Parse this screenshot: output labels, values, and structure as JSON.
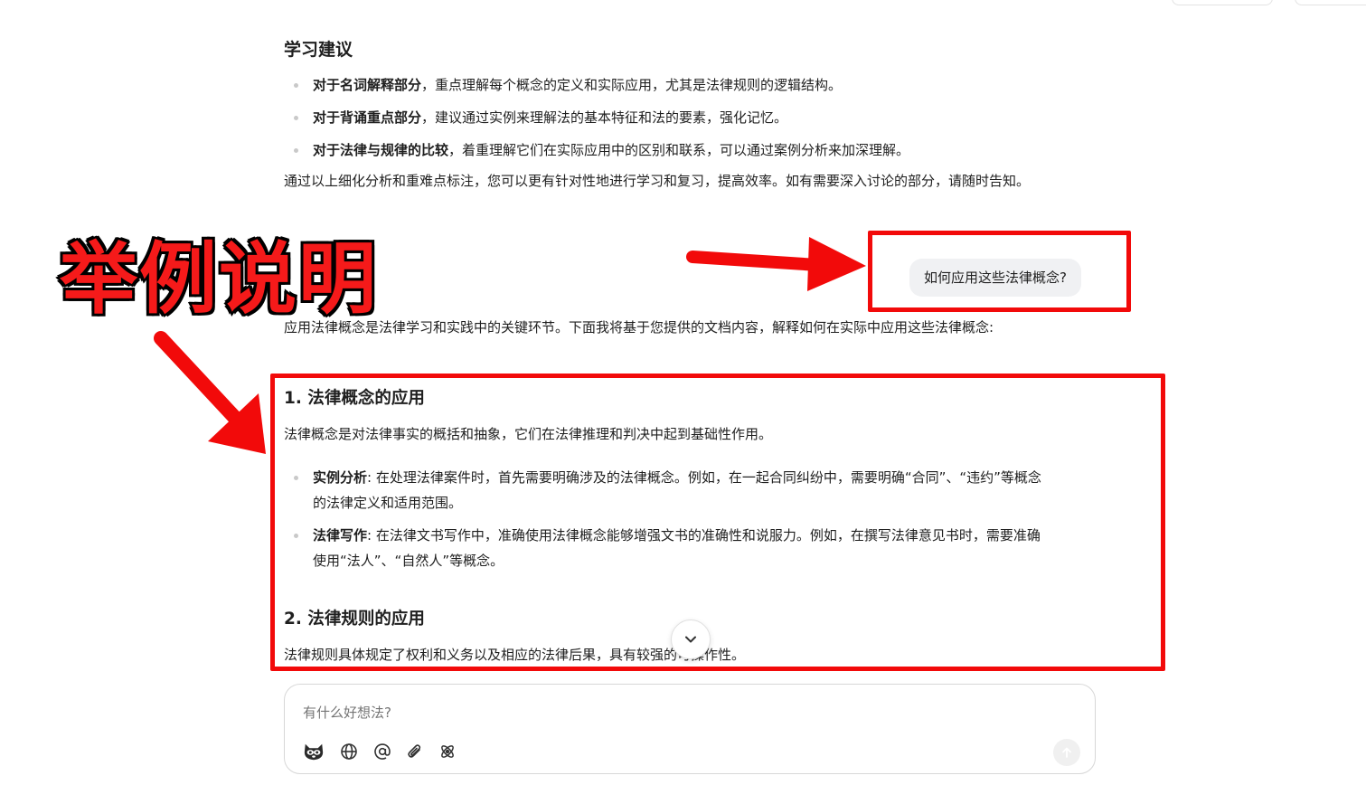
{
  "study_suggestions": {
    "heading": "学习建议",
    "items": [
      {
        "bold": "对于名词解释部分",
        "text": "，重点理解每个概念的定义和实际应用，尤其是法律规则的逻辑结构。"
      },
      {
        "bold": "对于背诵重点部分",
        "text": "，建议通过实例来理解法的基本特征和法的要素，强化记忆。"
      },
      {
        "bold": "对于法律与规律的比较",
        "text": "，着重理解它们在实际应用中的区别和联系，可以通过案例分析来加深理解。"
      }
    ],
    "closing": "通过以上细化分析和重难点标注，您可以更有针对性地进行学习和复习，提高效率。如有需要深入讨论的部分，请随时告知。"
  },
  "annotation": {
    "label": "举例说明"
  },
  "user_message": "如何应用这些法律概念?",
  "answer": {
    "intro": "应用法律概念是法律学习和实践中的关键环节。下面我将基于您提供的文档内容，解释如何在实际中应用这些法律概念:",
    "section1": {
      "heading": "1. 法律概念的应用",
      "desc": "法律概念是对法律事实的概括和抽象，它们在法律推理和判决中起到基础性作用。",
      "items": [
        {
          "bold": "实例分析",
          "line1": ": 在处理法律案件时，首先需要明确涉及的法律概念。例如，在一起合同纠纷中，需要明确“合同”、“违约”等概念",
          "line2": "的法律定义和适用范围。"
        },
        {
          "bold": "法律写作",
          "line1": ": 在法律文书写作中，准确使用法律概念能够增强文书的准确性和说服力。例如，在撰写法律意见书时，需要准确",
          "line2": "使用“法人”、“自然人”等概念。"
        }
      ]
    },
    "section2": {
      "heading": "2. 法律规则的应用",
      "desc": "法律规则具体规定了权利和义务以及相应的法律后果，具有较强的可操作性。"
    }
  },
  "composer": {
    "placeholder": "有什么好想法?",
    "tools": [
      "raccoon-icon",
      "globe-icon",
      "at-icon",
      "paperclip-icon",
      "atom-icon"
    ],
    "send_icon": "arrow-up-icon"
  },
  "colors": {
    "annotation_red": "#f20a0a",
    "bubble_bg": "#f0f1f3",
    "bullet": "#c9c9c9"
  }
}
